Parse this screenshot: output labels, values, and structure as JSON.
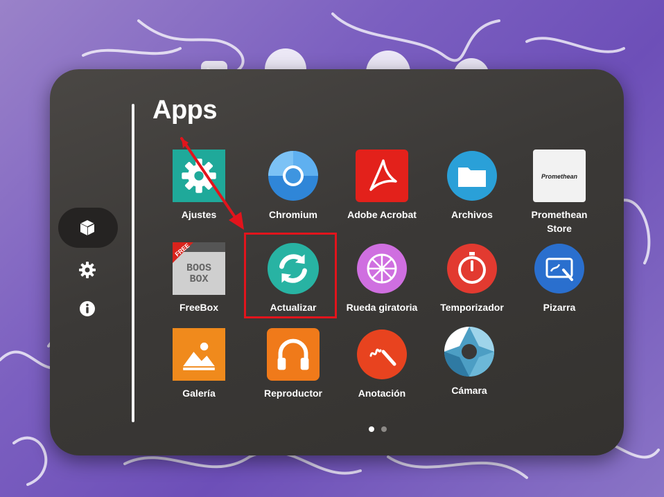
{
  "header": {
    "title": "Apps"
  },
  "sidebar": {
    "items": [
      {
        "name": "apps",
        "icon": "cube-icon",
        "active": true
      },
      {
        "name": "settings",
        "icon": "gear-icon",
        "active": false
      },
      {
        "name": "info",
        "icon": "info-icon",
        "active": false
      }
    ]
  },
  "apps": [
    {
      "label": "Ajustes",
      "icon": "settings-gear-icon",
      "color": "#1fa99a"
    },
    {
      "label": "Chromium",
      "icon": "chromium-icon",
      "color": "#4a9fe6"
    },
    {
      "label": "Adobe Acrobat",
      "icon": "acrobat-icon",
      "color": "#e3211b"
    },
    {
      "label": "Archivos",
      "icon": "folder-icon",
      "color": "#2aa0d8"
    },
    {
      "label": "Promethean Store",
      "icon": "promethean-store-icon",
      "color": "#f2f2f2",
      "logo_text": "Promethean"
    },
    {
      "label": "FreeBox",
      "icon": "freebox-icon",
      "color": "#d8d8d8",
      "badge": "FREE",
      "logo_text": "BOOS BOX"
    },
    {
      "label": "Actualizar",
      "icon": "refresh-icon",
      "color": "#28b3a3"
    },
    {
      "label": "Rueda giratoria",
      "icon": "wheel-icon",
      "color": "#cf6fe0"
    },
    {
      "label": "Temporizador",
      "icon": "timer-icon",
      "color": "#e23a30"
    },
    {
      "label": "Pizarra",
      "icon": "whiteboard-icon",
      "color": "#2a6fce"
    },
    {
      "label": "Galería",
      "icon": "gallery-icon",
      "color": "#f08a1c"
    },
    {
      "label": "Reproductor",
      "icon": "headphones-icon",
      "color": "#f07a1a"
    },
    {
      "label": "Anotación",
      "icon": "annotation-icon",
      "color": "#e8431f"
    },
    {
      "label": "Cámara",
      "icon": "camera-shutter-icon",
      "color": "#4c9ec4"
    }
  ],
  "pagination": {
    "current": 1,
    "total": 2
  },
  "annotation": {
    "highlight_color": "#e2141c"
  }
}
